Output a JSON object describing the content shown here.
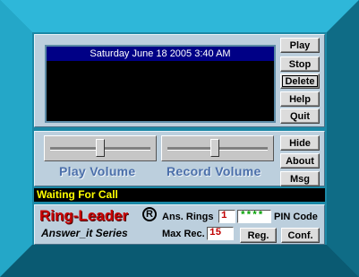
{
  "display": {
    "datetime": "Saturday June 18 2005 3:40 AM"
  },
  "buttons": {
    "play": "Play",
    "stop": "Stop",
    "delete": "Delete",
    "help": "Help",
    "quit": "Quit",
    "hide": "Hide",
    "about": "About",
    "msg": "Msg",
    "reg": "Reg.",
    "conf": "Conf."
  },
  "volume": {
    "play_label": "Play Volume",
    "play_level": 0.5,
    "record_label": "Record Volume",
    "record_level": 0.47
  },
  "status": {
    "text": "Waiting For Call"
  },
  "brand": {
    "name": "Ring-Leader",
    "symbol": "R",
    "series": "Answer_it Series"
  },
  "settings": {
    "ans_rings_label": "Ans. Rings",
    "ans_rings": "1",
    "pin_value": "****",
    "pin_label": "PIN Code",
    "max_rec_label": "Max Rec.",
    "max_rec": "15"
  },
  "colors": {
    "frame": "#1b88a6",
    "panel": "#bccfdd",
    "title_bar": "#000086",
    "status_text": "#ffff00",
    "brand": "#c80000",
    "volume_label": "#4b6faa"
  }
}
